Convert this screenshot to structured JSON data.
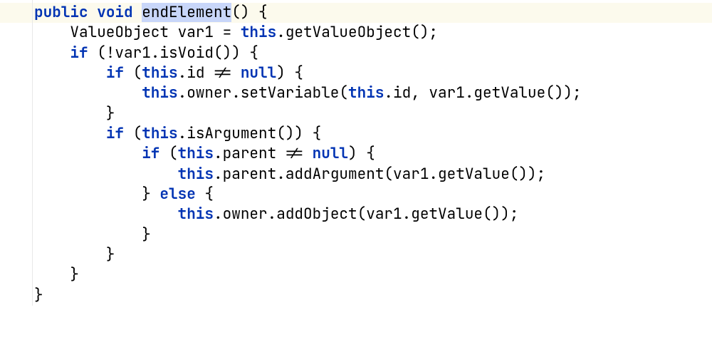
{
  "code": {
    "l1_public": "public",
    "l1_void": "void",
    "l1_space1": " ",
    "l1_space2": " ",
    "l1_method": "endElement",
    "l1_rest": "() {",
    "l2": "    ValueObject var1 = ",
    "l2_this": "this",
    "l2_rest": ".getValueObject();",
    "l3_a": "    ",
    "l3_if": "if",
    "l3_b": " (!var1.isVoid()) {",
    "l4_a": "        ",
    "l4_if": "if",
    "l4_b": " (",
    "l4_this": "this",
    "l4_c": ".id != ",
    "l4_null": "null",
    "l4_d": ") {",
    "l5_a": "            ",
    "l5_this": "this",
    "l5_b": ".owner.setVariable(",
    "l5_this2": "this",
    "l5_c": ".id, var1.getValue());",
    "l6": "        }",
    "l7": "",
    "l8_a": "        ",
    "l8_if": "if",
    "l8_b": " (",
    "l8_this": "this",
    "l8_c": ".isArgument()) {",
    "l9_a": "            ",
    "l9_if": "if",
    "l9_b": " (",
    "l9_this": "this",
    "l9_c": ".parent != ",
    "l9_null": "null",
    "l9_d": ") {",
    "l10_a": "                ",
    "l10_this": "this",
    "l10_b": ".parent.addArgument(var1.getValue());",
    "l11_a": "            } ",
    "l11_else": "else",
    "l11_b": " {",
    "l12_a": "                ",
    "l12_this": "this",
    "l12_b": ".owner.addObject(var1.getValue());",
    "l13": "            }",
    "l14": "        }",
    "l15": "    }",
    "l16": "",
    "l17": "}"
  }
}
